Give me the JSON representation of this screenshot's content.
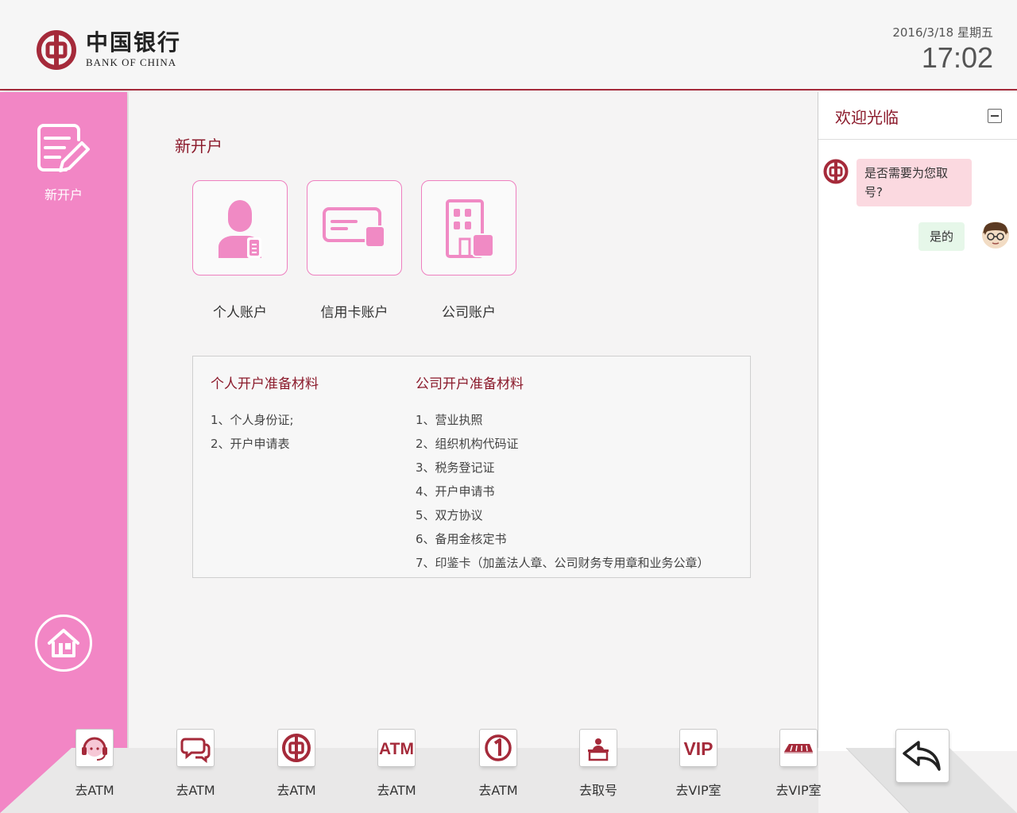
{
  "header": {
    "logo_cn": "中国银行",
    "logo_en": "BANK OF CHINA",
    "date": "2016/3/18 星期五",
    "time": "17:02"
  },
  "sidebar": {
    "items": [
      {
        "label": "新开户",
        "icon": "form-edit-icon"
      }
    ],
    "home_icon": "home-icon"
  },
  "main": {
    "title": "新开户",
    "account_types": [
      {
        "label": "个人账户",
        "icon": "person-icon"
      },
      {
        "label": "信用卡账户",
        "icon": "credit-card-icon"
      },
      {
        "label": "公司账户",
        "icon": "building-icon"
      }
    ],
    "materials": {
      "personal": {
        "title": "个人开户准备材料",
        "items": [
          "1、个人身份证;",
          "2、开户申请表"
        ]
      },
      "company": {
        "title": "公司开户准备材料",
        "items": [
          "1、营业执照",
          "2、组织机构代码证",
          "3、税务登记证",
          "4、开户申请书",
          "5、双方协议",
          "6、备用金核定书",
          "7、印鉴卡（加盖法人章、公司财务专用章和业务公章）"
        ]
      }
    }
  },
  "chat": {
    "title": "欢迎光临",
    "messages": [
      {
        "from": "bank",
        "text": "是否需要为您取号?"
      },
      {
        "from": "user",
        "text": "是的"
      }
    ]
  },
  "dock": {
    "items": [
      {
        "label": "去ATM",
        "icon": "customer-service-icon"
      },
      {
        "label": "去ATM",
        "icon": "chat-bubbles-icon"
      },
      {
        "label": "去ATM",
        "icon": "bank-logo-icon"
      },
      {
        "label": "去ATM",
        "icon": "atm-icon"
      },
      {
        "label": "去ATM",
        "icon": "number-one-icon"
      },
      {
        "label": "去取号",
        "icon": "counter-icon"
      },
      {
        "label": "去VIP室",
        "icon": "vip-icon"
      },
      {
        "label": "去VIP室",
        "icon": "vip-card-icon"
      }
    ],
    "back_icon": "back-arrow-icon"
  },
  "colors": {
    "brand_red": "#a52a3a",
    "title_red": "#8b1a2b",
    "sidebar_pink": "#f286c5",
    "card_pink": "#ee7fbf",
    "icon_pink": "#f08ac4",
    "bubble_pink": "#fbd9e0",
    "bubble_green": "#e6f7e9"
  }
}
